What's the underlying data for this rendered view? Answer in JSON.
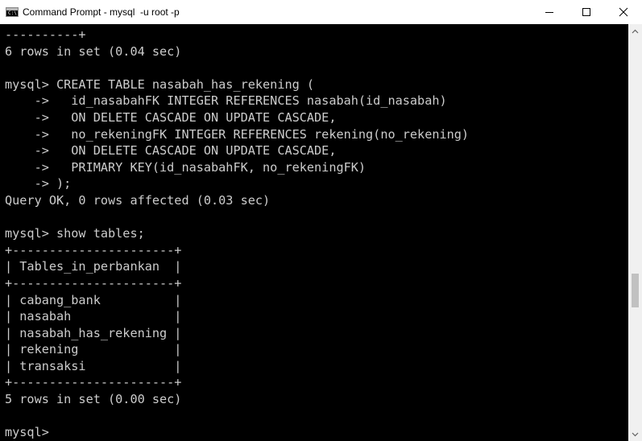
{
  "window": {
    "title": "Command Prompt - mysql  -u root -p"
  },
  "terminal": {
    "lines": [
      "----------+",
      "6 rows in set (0.04 sec)",
      "",
      "mysql> CREATE TABLE nasabah_has_rekening (",
      "    ->   id_nasabahFK INTEGER REFERENCES nasabah(id_nasabah)",
      "    ->   ON DELETE CASCADE ON UPDATE CASCADE,",
      "    ->   no_rekeningFK INTEGER REFERENCES rekening(no_rekening)",
      "    ->   ON DELETE CASCADE ON UPDATE CASCADE,",
      "    ->   PRIMARY KEY(id_nasabahFK, no_rekeningFK)",
      "    -> );",
      "Query OK, 0 rows affected (0.03 sec)",
      "",
      "mysql> show tables;",
      "+----------------------+",
      "| Tables_in_perbankan  |",
      "+----------------------+",
      "| cabang_bank          |",
      "| nasabah              |",
      "| nasabah_has_rekening |",
      "| rekening             |",
      "| transaksi            |",
      "+----------------------+",
      "5 rows in set (0.00 sec)",
      "",
      "mysql> "
    ]
  },
  "colors": {
    "terminal_bg": "#000000",
    "terminal_fg": "#cccccc",
    "titlebar_bg": "#ffffff",
    "scrollbar_bg": "#f0f0f0",
    "scrollbar_thumb": "#c1c1c1"
  },
  "icons": {
    "app": "command-prompt-icon",
    "minimize": "minimize-icon",
    "maximize": "maximize-icon",
    "close": "close-icon",
    "scroll_up": "scroll-up-arrow-icon",
    "scroll_down": "scroll-down-arrow-icon"
  }
}
